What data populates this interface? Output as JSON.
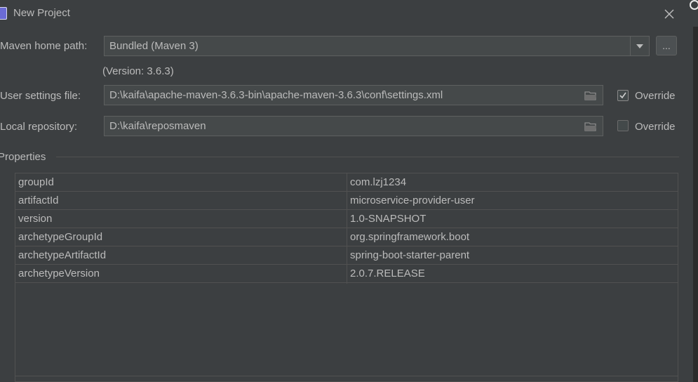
{
  "window": {
    "title": "New Project",
    "close_icon": "close-icon"
  },
  "maven": {
    "home_label": "Maven home path:",
    "home_value": "Bundled (Maven 3)",
    "browse_label": "...",
    "version_text": "(Version: 3.6.3)",
    "settings_label": "User settings file:",
    "settings_value": "D:\\kaifa\\apache-maven-3.6.3-bin\\apache-maven-3.6.3\\conf\\settings.xml",
    "settings_override_label": "Override",
    "settings_override_checked": true,
    "repo_label": "Local repository:",
    "repo_value": "D:\\kaifa\\reposmaven",
    "repo_override_label": "Override",
    "repo_override_checked": false
  },
  "properties": {
    "title": "Properties",
    "rows": [
      {
        "key": "groupId",
        "value": "com.lzj1234"
      },
      {
        "key": "artifactId",
        "value": "microservice-provider-user"
      },
      {
        "key": "version",
        "value": "1.0-SNAPSHOT"
      },
      {
        "key": "archetypeGroupId",
        "value": "org.springframework.boot"
      },
      {
        "key": "archetypeArtifactId",
        "value": "spring-boot-starter-parent"
      },
      {
        "key": "archetypeVersion",
        "value": "2.0.7.RELEASE"
      }
    ]
  },
  "colors": {
    "background": "#3c3f41",
    "field": "#45494a",
    "border": "#5e6060",
    "text": "#bbbbbb"
  }
}
